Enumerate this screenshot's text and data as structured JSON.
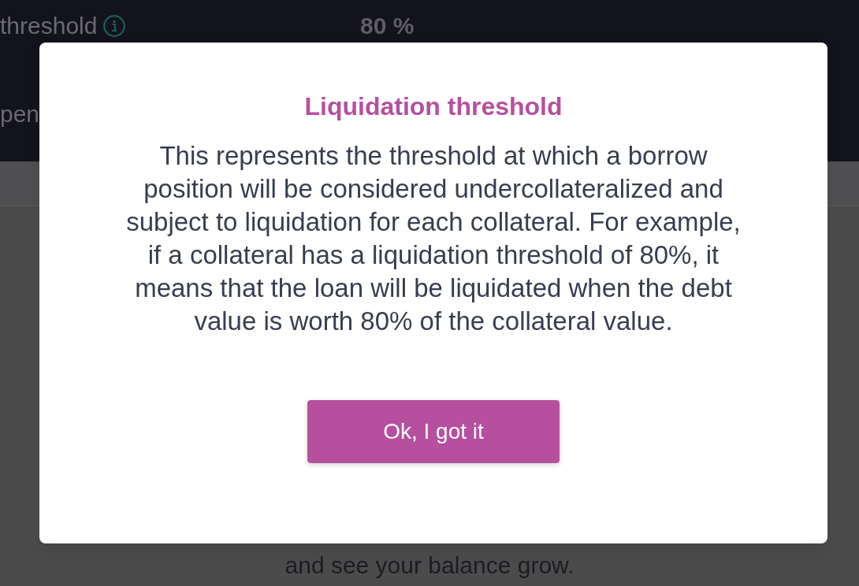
{
  "background": {
    "rows": [
      {
        "label": "threshold",
        "info_icon": true,
        "value": "80 %"
      },
      {
        "label": "pen",
        "info_icon": false
      }
    ],
    "footer_text": "and see your balance grow."
  },
  "dialog": {
    "title": "Liquidation threshold",
    "body": "This represents the threshold at which a borrow position will be considered undercollateralized and subject to liquidation for each collateral. For example, if a collateral has a liquidation threshold of 80%, it means that the loan will be liquidated when the debt value is worth 80% of the collateral value.",
    "button": "Ok, I got it"
  }
}
